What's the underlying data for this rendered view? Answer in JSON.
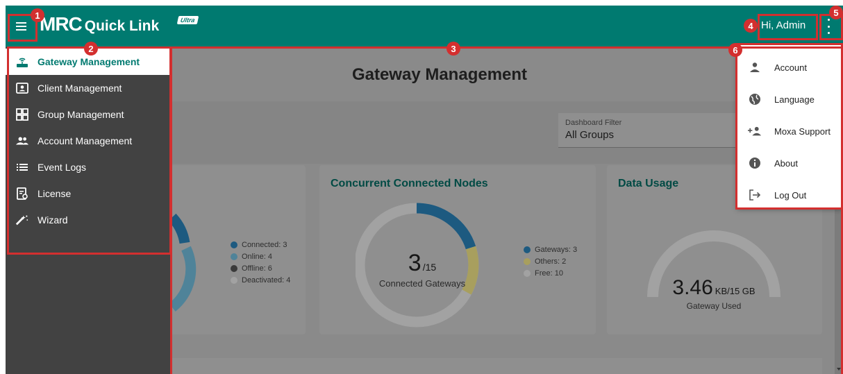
{
  "app": {
    "title_mrc": "MRC",
    "title_ql": "Quick Link",
    "title_badge": "Ultra",
    "greeting": "Hi, Admin",
    "accent_color": "#007a70"
  },
  "sidebar": {
    "items": [
      {
        "label": "Gateway Management",
        "icon": "router-wifi-icon",
        "active": true
      },
      {
        "label": "Client Management",
        "icon": "account-box-icon"
      },
      {
        "label": "Group Management",
        "icon": "grid-icon"
      },
      {
        "label": "Account Management",
        "icon": "people-icon"
      },
      {
        "label": "Event Logs",
        "icon": "list-icon"
      },
      {
        "label": "License",
        "icon": "license-icon"
      },
      {
        "label": "Wizard",
        "icon": "magic-wand-icon"
      }
    ]
  },
  "main": {
    "page_title": "Gateway Management",
    "filter": {
      "label": "Dashboard Filter",
      "value": "All Groups"
    },
    "gateways_card": {
      "legend": [
        {
          "label": "Connected: 3",
          "color": "#1d5a80"
        },
        {
          "label": "Online: 4",
          "color": "#4f8399"
        },
        {
          "label": "Offline: 6",
          "color": "#3a3a3a"
        },
        {
          "label": "Deactivated: 4",
          "color": "#a2a2a2"
        }
      ]
    },
    "nodes_card": {
      "title": "Concurrent Connected Nodes",
      "value": "3",
      "max": "/15",
      "caption": "Connected Gateways",
      "legend": [
        {
          "label": "Gateways: 3",
          "color": "#1d5a80"
        },
        {
          "label": "Others: 2",
          "color": "#a89f5e"
        },
        {
          "label": "Free: 10",
          "color": "#a2a2a2"
        }
      ]
    },
    "data_card": {
      "title": "Data Usage",
      "value": "3.46",
      "unit": "KB/15 GB",
      "caption": "Gateway Used"
    }
  },
  "account_menu": {
    "items": [
      {
        "label": "Account",
        "icon": "person-icon"
      },
      {
        "label": "Language",
        "icon": "globe-icon"
      },
      {
        "label": "Moxa Support",
        "icon": "person-add-icon"
      },
      {
        "label": "About",
        "icon": "info-icon"
      },
      {
        "label": "Log Out",
        "icon": "logout-icon"
      }
    ]
  },
  "annotations": [
    "1",
    "2",
    "3",
    "4",
    "5",
    "6"
  ]
}
